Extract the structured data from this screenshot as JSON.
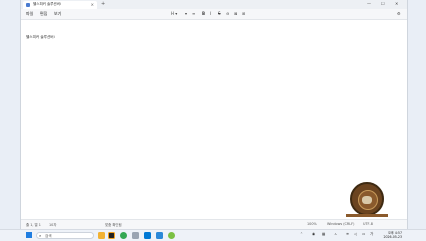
{
  "window": {
    "tab_title": "헬스피커 솔루션버i",
    "new_tab": "+",
    "close_tab": "×",
    "controls": [
      "—",
      "☐",
      "✕"
    ]
  },
  "menubar": {
    "items": [
      "파일",
      "편집",
      "보기"
    ],
    "tools": [
      "H ▾",
      "▾",
      "≡",
      "B",
      "I",
      "S",
      "⊖",
      "⊠",
      "⊞",
      "⚙"
    ]
  },
  "editor": {
    "text": "헬스피커 솔루션버i"
  },
  "statusbar": {
    "position": "줄 1, 열 1",
    "chars": "10자",
    "spell": "맞춤 확인됨",
    "zoom": "100%",
    "line_ending": "Windows (CRLF)",
    "encoding": "UTF-8"
  },
  "taskbar": {
    "search_placeholder": "검색",
    "tray_lang": "ㅅ",
    "tray_ime": "가",
    "time": "오후 4:57",
    "date": "2026-05-23"
  },
  "colors": {
    "accent": "#1f7de0",
    "widget": "#6b4420"
  }
}
